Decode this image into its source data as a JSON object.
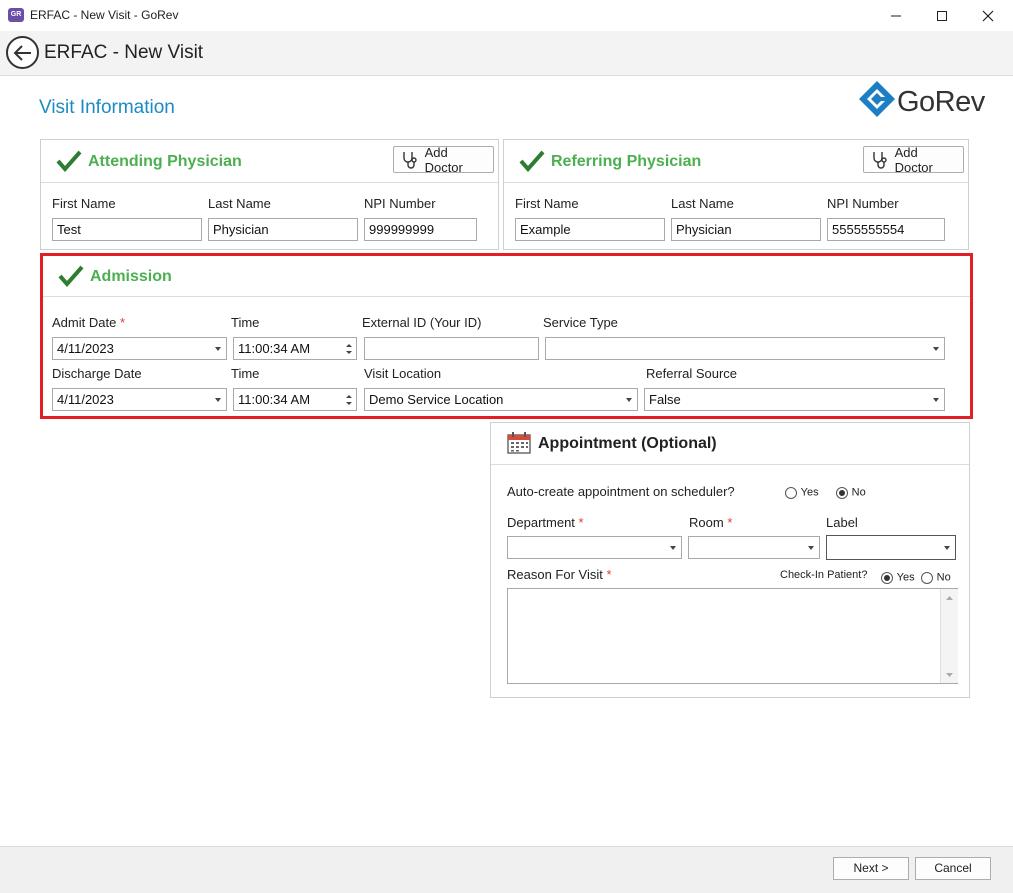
{
  "window": {
    "title": "ERFAC - New Visit - GoRev",
    "app_icon": "GoRev"
  },
  "header": {
    "title": "ERFAC - New Visit"
  },
  "page": {
    "heading": "Visit Information",
    "logo_text": "GoRev"
  },
  "attending": {
    "title": "Attending Physician",
    "add_label": "Add Doctor",
    "first_name_label": "First Name",
    "first_name": "Test",
    "last_name_label": "Last Name",
    "last_name": "Physician",
    "npi_label": "NPI Number",
    "npi": "999999999"
  },
  "referring": {
    "title": "Referring Physician",
    "add_label": "Add Doctor",
    "first_name_label": "First Name",
    "first_name": "Example",
    "last_name_label": "Last Name",
    "last_name": "Physician",
    "npi_label": "NPI Number",
    "npi": "5555555554"
  },
  "admission": {
    "title": "Admission",
    "admit_date_label": "Admit Date",
    "required_mark": "*",
    "admit_date": "4/11/2023",
    "admit_time_label": "Time",
    "admit_time": "11:00:34 AM",
    "external_id_label": "External ID (Your ID)",
    "external_id": "",
    "service_type_label": "Service Type",
    "service_type": "",
    "discharge_date_label": "Discharge Date",
    "discharge_date": "4/11/2023",
    "discharge_time_label": "Time",
    "discharge_time": "11:00:34 AM",
    "visit_location_label": "Visit Location",
    "visit_location": "Demo Service Location",
    "referral_source_label": "Referral Source",
    "referral_source": "False"
  },
  "appointment": {
    "title": "Appointment (Optional)",
    "auto_create_label": "Auto-create appointment on scheduler?",
    "yes_label": "Yes",
    "no_label": "No",
    "auto_create_value": "No",
    "department_label": "Department",
    "department": "",
    "room_label": "Room",
    "room": "",
    "label_label": "Label",
    "label_value": "",
    "reason_label": "Reason For Visit",
    "reason": "",
    "checkin_label": "Check-In Patient?",
    "checkin_value": "Yes"
  },
  "footer": {
    "next_label": "Next >",
    "cancel_label": "Cancel"
  },
  "colors": {
    "accent_blue": "#1c8bc4",
    "section_green": "#4caf50",
    "highlight_red": "#e31e24"
  }
}
